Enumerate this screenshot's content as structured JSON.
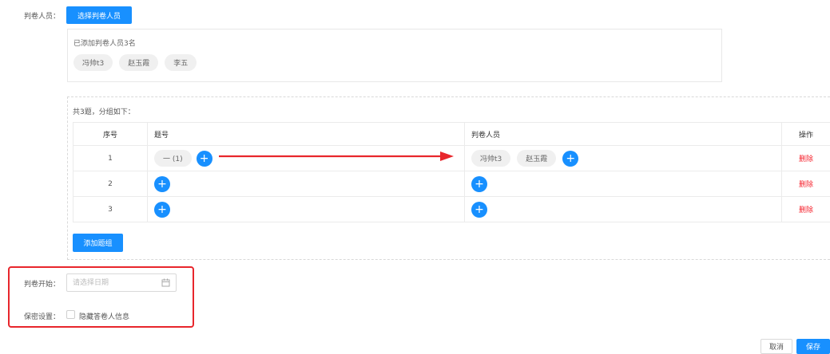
{
  "graders": {
    "label": "判卷人员：",
    "select_button": "选择判卷人员",
    "added_text": "已添加判卷人员3名",
    "tags": [
      "冯帅t3",
      "赵玉霞",
      "李五"
    ]
  },
  "groups": {
    "summary": "共3题，分组如下：",
    "columns": [
      "序号",
      "题号",
      "判卷人员",
      "操作"
    ],
    "rows": [
      {
        "index": "1",
        "question_tag": "一 (1)",
        "grader_tags": [
          "冯帅t3",
          "赵玉霞"
        ],
        "action": "删除"
      },
      {
        "index": "2",
        "action": "删除"
      },
      {
        "index": "3",
        "action": "删除"
      }
    ],
    "add_group_button": "添加题组",
    "plus_symbol": "+"
  },
  "grading_start": {
    "label": "判卷开始：",
    "placeholder": "请选择日期"
  },
  "confidential": {
    "label": "保密设置：",
    "checkbox_label": "隐藏答卷人信息"
  },
  "footer": {
    "cancel_label": "取消",
    "save_label": "保存"
  },
  "colors": {
    "primary": "#1890ff",
    "danger": "#f5222d",
    "highlight_box": "#e8262c",
    "arrow": "#e8262c"
  },
  "icons": [
    "plus-icon",
    "calendar-icon",
    "arrow-annotation"
  ]
}
